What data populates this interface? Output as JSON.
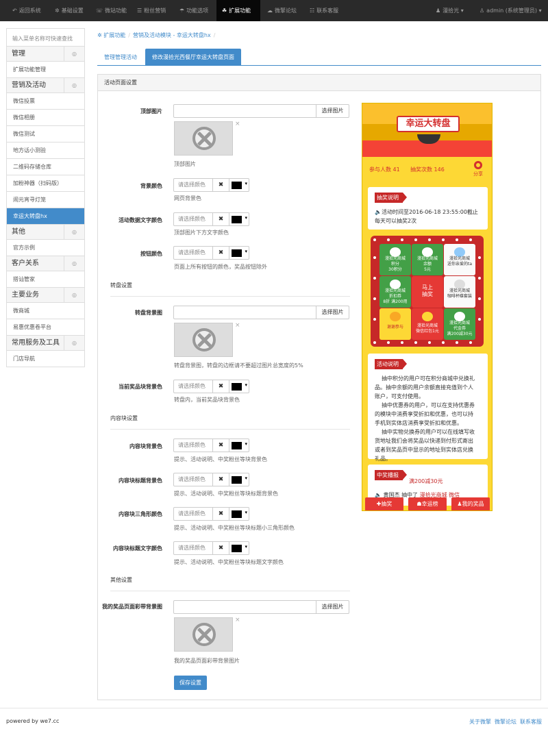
{
  "topnav": {
    "items": [
      {
        "icon": "↶",
        "label": "返回系统"
      },
      {
        "icon": "✲",
        "label": "基础设置"
      },
      {
        "icon": "☏",
        "label": "微站功能"
      },
      {
        "icon": "☰",
        "label": "粉丝营销"
      },
      {
        "icon": "☂",
        "label": "功能选项"
      },
      {
        "icon": "☘",
        "label": "扩展功能"
      },
      {
        "icon": "☁",
        "label": "微擎论坛"
      },
      {
        "icon": "☷",
        "label": "联系客服"
      }
    ],
    "account": "漫拾光 ▾",
    "user": "admin (系统管理员) ▾"
  },
  "sidebar": {
    "search_placeholder": "输入菜单名称可快速查找",
    "toggle": "◎",
    "groups": [
      {
        "label": "管理",
        "items": [
          "扩展功能管理"
        ]
      },
      {
        "label": "营销及活动",
        "items": [
          "微信投票",
          "微信相册",
          "微信测试",
          "地方话小测验",
          "二维码存储仓库",
          "加粉神器（扫码版）",
          "闹元宵寻灯笼",
          "幸运大转盘hx"
        ]
      },
      {
        "label": "其他",
        "items": [
          "官方示例"
        ]
      },
      {
        "label": "客户关系",
        "items": [
          "搭讪管家"
        ]
      },
      {
        "label": "主要业务",
        "items": [
          "微商城",
          "易惠优惠卷平台"
        ]
      },
      {
        "label": "常用服务及工具",
        "items": [
          "门店导航"
        ]
      }
    ]
  },
  "breadcrumb": {
    "icon": "✲",
    "items": [
      "扩展功能",
      "营销及活动模块 - 幸运大转盘hx"
    ]
  },
  "tabs": [
    "管理管理活动",
    "修改漫拾光西餐厅幸运大转盘页面"
  ],
  "panel": {
    "title": "活动页面设置",
    "pick_image": "选择图片",
    "color_placeholder": "请选择颜色",
    "clear": "✖",
    "close": "×",
    "save": "保存设置",
    "sections": {
      "wheel": "转盘设置",
      "content": "内容块设置",
      "other": "其他设置"
    },
    "fields": {
      "top_image": {
        "label": "顶部图片",
        "help": "顶部图片"
      },
      "bg_color": {
        "label": "背景颜色",
        "help": "网页背景色"
      },
      "data_text_color": {
        "label": "活动数据文字颜色",
        "help": "顶部图片下方文字颜色"
      },
      "button_color": {
        "label": "按钮颜色",
        "help": "页面上所有按钮的颜色，奖品按钮除外"
      },
      "wheel_bg": {
        "label": "转盘背景图",
        "help": "转盘背景图，转盘的边框请不要超过图片总宽度的5%"
      },
      "current_prize_bg": {
        "label": "当前奖品块背景色",
        "help": "转盘内，当前奖品块背景色"
      },
      "block_bg": {
        "label": "内容块背景色",
        "help": "提示、活动说明、中奖粉丝等块背景色"
      },
      "block_title_bg": {
        "label": "内容块标题背景色",
        "help": "提示、活动说明、中奖粉丝等块标题背景色"
      },
      "block_triangle": {
        "label": "内容块三角形颜色",
        "help": "提示、活动说明、中奖粉丝等块标题小三角形颜色"
      },
      "block_title_text": {
        "label": "内容块标题文字颜色",
        "help": "提示、活动说明、中奖粉丝等块标题文字颜色"
      },
      "my_prize_bg": {
        "label": "我的奖品页面彩带背景图",
        "help": "我的奖品页面彩带背景图片"
      }
    }
  },
  "preview": {
    "banner_title": "幸运大转盘",
    "participants": "参与人数 41",
    "draws": "抽奖次数 146",
    "share": "分享",
    "draw_info_title": "抽奖说明",
    "draw_info_line1": "🔈活动时间至2016-06-18 23:55:00截止",
    "draw_info_line2": "每天可以抽奖2次",
    "prizes": [
      {
        "line1": "漫拾光商城",
        "line2": "积分",
        "line3": "30积分"
      },
      {
        "line1": "漫拾光商城",
        "line2": "余额",
        "line3": "5元"
      },
      {
        "line1": "漫拾光商城",
        "line2": "",
        "line3": "送你亲爱的ta"
      },
      {
        "line1": "漫拾光商城",
        "line2": "折扣券",
        "line3": "8折 满200用"
      },
      {
        "line1": "马上",
        "line2": "抽奖",
        "line3": ""
      },
      {
        "line1": "漫拾光商城",
        "line2": "",
        "line3": "咖啡杯碟套装"
      },
      {
        "line1": "谢谢参与",
        "line2": "",
        "line3": ""
      },
      {
        "line1": "漫拾光商城",
        "line2": "微信红包1元",
        "line3": ""
      },
      {
        "line1": "漫拾光商城",
        "line2": "代金券",
        "line3": "满200减30元"
      }
    ],
    "activity_title": "活动说明",
    "activity_lines": [
      "抽中积分的用户可在积分商城中兑换礼",
      "品。抽中余额的用户余额直接充值到个人",
      "账户，可支付使用。",
      "抽中优惠券的用户，可以在支持优惠券",
      "的模块中消费享受折扣和优惠，也可以持",
      "手机到实体店消费享受折扣和优惠。",
      "抽中实物兑换券的用户可以在线填写收",
      "货地址我们会将奖品以快递到付形式寄出",
      "或者到奖品页中显示的地址到实体店兑换",
      "礼品。"
    ],
    "winners_title": "中奖播报",
    "winner_partial": "满200减30元",
    "winner_name": "黄国杰",
    "winner_text": "抽中了",
    "winner_prize": "漫拾光商城 微信",
    "buttons": [
      "✚抽奖",
      "☗幸运榜",
      "♟我的奖品"
    ]
  },
  "footer": {
    "powered": "powered by we7.cc",
    "links": [
      "关于微擎",
      "微擎论坛",
      "联系客服"
    ]
  }
}
